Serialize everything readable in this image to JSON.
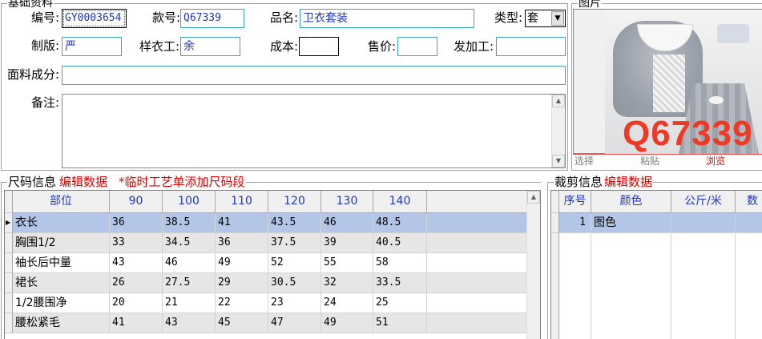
{
  "basic": {
    "title": "基础资料",
    "code_label": "编号:",
    "code_value": "GY0003654",
    "style_label": "款号:",
    "style_value": "Q67339",
    "name_label": "品名:",
    "name_value": "卫衣套装",
    "type_label": "类型:",
    "type_value": "套",
    "pattern_label": "制版:",
    "pattern_value": "严",
    "sample_label": "样衣工:",
    "sample_value": "余",
    "cost_label": "成本:",
    "cost_value": "",
    "price_label": "售价:",
    "price_value": "",
    "outsource_label": "发加工:",
    "outsource_value": "",
    "fabric_label": "面料成分:",
    "fabric_value": "",
    "remark_label": "备注:",
    "remark_value": ""
  },
  "image_panel": {
    "title": "图片",
    "watermark": "Q67339",
    "select_label": "选择",
    "paste_label": "粘贴",
    "browse_label": "浏览"
  },
  "size_section": {
    "title": "尺码信息",
    "edit_link": "编辑数据",
    "note": "*临时工艺单添加尺码段",
    "headers": [
      "部位",
      "90",
      "100",
      "110",
      "120",
      "130",
      "140"
    ],
    "rows": [
      [
        "衣长",
        "36",
        "38.5",
        "41",
        "43.5",
        "46",
        "48.5"
      ],
      [
        "胸围1/2",
        "33",
        "34.5",
        "36",
        "37.5",
        "39",
        "40.5"
      ],
      [
        "袖长后中量",
        "43",
        "46",
        "49",
        "52",
        "55",
        "58"
      ],
      [
        "裙长",
        "26",
        "27.5",
        "29",
        "30.5",
        "32",
        "33.5"
      ],
      [
        "1/2腰围净",
        "20",
        "21",
        "22",
        "23",
        "24",
        "25"
      ],
      [
        "腰松紧毛",
        "41",
        "43",
        "45",
        "47",
        "49",
        "51"
      ]
    ]
  },
  "cut_section": {
    "title": "裁剪信息",
    "edit_link": "编辑数据",
    "headers": [
      "序号",
      "颜色",
      "公斤/米",
      "数"
    ],
    "rows": [
      [
        "1",
        "图色",
        "",
        ""
      ]
    ]
  },
  "colors": {
    "accent_blue": "#1f35c4",
    "link_red": "#e00000",
    "selected_row": "#b4c6e7",
    "field_border": "#3aa7b5",
    "watermark_red": "#ee3a24"
  },
  "icons": {
    "scroll_up": "▲",
    "scroll_down": "▼",
    "dropdown": "▼",
    "row_pointer": "▶"
  }
}
